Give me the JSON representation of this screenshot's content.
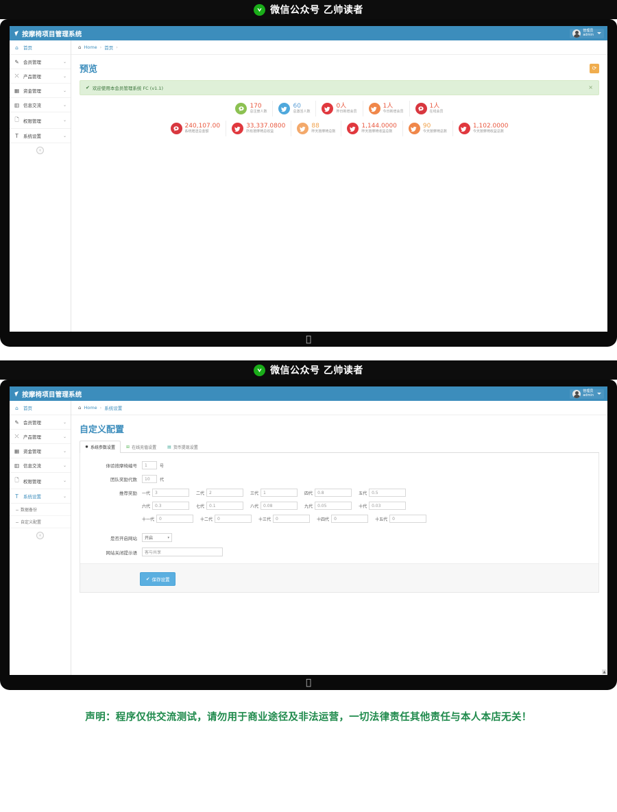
{
  "wechat_bar": {
    "logo_glyph": "W",
    "text": "微信公众号 乙帅读者"
  },
  "app": {
    "brand": "按摩椅项目管理系统",
    "user": {
      "role": "管理员",
      "name": "admin"
    }
  },
  "sidebar": {
    "items": [
      {
        "label": "首页",
        "icon": "home-icon",
        "glyph": "⌂",
        "has_caret": false,
        "active": true
      },
      {
        "label": "会员管理",
        "icon": "edit-icon",
        "glyph": "✎",
        "has_caret": true,
        "active": false
      },
      {
        "label": "产品管理",
        "icon": "shuffle-icon",
        "glyph": "⤫",
        "has_caret": true,
        "active": false
      },
      {
        "label": "资金管理",
        "icon": "calendar-icon",
        "glyph": "▤",
        "has_caret": true,
        "active": false
      },
      {
        "label": "信息交流",
        "icon": "table-icon",
        "glyph": "▥",
        "has_caret": true,
        "active": false
      },
      {
        "label": "权限管理",
        "icon": "file-icon",
        "glyph": "🗋",
        "has_caret": true,
        "active": false
      },
      {
        "label": "系统设置",
        "icon": "text-icon",
        "glyph": "T",
        "has_caret": true,
        "active": false
      }
    ],
    "submenu": [
      {
        "label": "数据备份"
      },
      {
        "label": "自定义配置"
      }
    ],
    "collapse_glyph": "‹"
  },
  "screen1": {
    "breadcrumb": {
      "home_icon": "home-icon",
      "home": "Home",
      "current": "首页",
      "sep": "›"
    },
    "page_title": "预览",
    "refresh_icon": "refresh-icon",
    "alert": {
      "check": "✔",
      "text": "欢迎使用本会员管理系统 FC (v1.1)",
      "close": "×"
    },
    "stats_row1": [
      {
        "value": "170",
        "label": "总注册人数",
        "color": "#8cc152",
        "icon": "comment-icon",
        "glyph": "💬"
      },
      {
        "value": "60",
        "label": "总激活人数",
        "color": "#4fa8dc",
        "icon": "bird-icon",
        "glyph": "🐦"
      },
      {
        "value": "0人",
        "label": "昨日新增会员",
        "color": "#e0383e",
        "icon": "bird-icon",
        "glyph": "🐦"
      },
      {
        "value": "1人",
        "label": "今日新增会员",
        "color": "#f0874a",
        "icon": "bird-icon",
        "glyph": "🐦"
      },
      {
        "value": "1人",
        "label": "在线会员",
        "color": "#d8373f",
        "icon": "comment-icon",
        "glyph": "💬"
      }
    ],
    "stats_row2": [
      {
        "value": "240,107.00",
        "label": "系统赠送总金额",
        "color": "#d8373f",
        "icon": "comment-icon",
        "glyph": "💬"
      },
      {
        "value": "33,337.0800",
        "label": "所有按摩椅总收益",
        "color": "#e0383e",
        "icon": "bird-icon",
        "glyph": "🐦"
      },
      {
        "value": "88",
        "label": "昨天按摩椅总数",
        "color": "#f0a濁4a",
        "icon": "bird-icon",
        "glyph": "🐦"
      },
      {
        "value": "1,144.0000",
        "label": "昨天按摩椅收益总数",
        "color": "#e0383e",
        "icon": "bird-icon",
        "glyph": "🐦"
      },
      {
        "value": "90",
        "label": "今天按摩椅总数",
        "color": "#f0874a",
        "icon": "bird-icon",
        "glyph": "🐦"
      },
      {
        "value": "1,102.0000",
        "label": "今天按摩椅收益总数",
        "color": "#e0383e",
        "icon": "bird-icon",
        "glyph": "🐦"
      }
    ]
  },
  "screen2": {
    "breadcrumb": {
      "home_icon": "home-icon",
      "home": "Home",
      "current": "系统设置",
      "sep": "›"
    },
    "page_title": "自定义配置",
    "tabs": [
      {
        "label": "系统参数设置",
        "glyph": "✹",
        "active": true
      },
      {
        "label": "在线充值设置",
        "glyph": "✚",
        "active": false
      },
      {
        "label": "货币提现设置",
        "glyph": "▤",
        "active": false
      }
    ],
    "form": {
      "chair_no": {
        "label": "体验按摩椅编号",
        "value": "1",
        "unit": "号"
      },
      "team_levels": {
        "label": "团队奖励代数",
        "value": "10",
        "unit": "代"
      },
      "reward_label": "推荐奖励",
      "rewards": [
        [
          {
            "label": "一代",
            "value": "3"
          },
          {
            "label": "二代",
            "value": "2"
          },
          {
            "label": "三代",
            "value": "1"
          },
          {
            "label": "四代",
            "value": "0.8"
          },
          {
            "label": "五代",
            "value": "0.5"
          }
        ],
        [
          {
            "label": "六代",
            "value": "0.3"
          },
          {
            "label": "七代",
            "value": "0.1"
          },
          {
            "label": "八代",
            "value": "0.08"
          },
          {
            "label": "九代",
            "value": "0.05"
          },
          {
            "label": "十代",
            "value": "0.03"
          }
        ],
        [
          {
            "label": "十一代",
            "value": "0"
          },
          {
            "label": "十二代",
            "value": "0"
          },
          {
            "label": "十三代",
            "value": "0"
          },
          {
            "label": "十四代",
            "value": "0"
          },
          {
            "label": "十五代",
            "value": "0"
          }
        ]
      ],
      "site_enable": {
        "label": "是否开启网站",
        "value": "开启",
        "caret": "▾"
      },
      "site_closed_msg": {
        "label": "网站关闭提示语",
        "placeholder": "客与共享",
        "value": ""
      },
      "save_button": {
        "label": "保存设置",
        "check": "✔"
      }
    },
    "scroll_hint": "▲"
  },
  "footer": {
    "declaration": "声明：程序仅供交流测试，请勿用于商业途径及非法运营，一切法律责任其他责任与本人本店无关！"
  },
  "apple_glyph": ""
}
